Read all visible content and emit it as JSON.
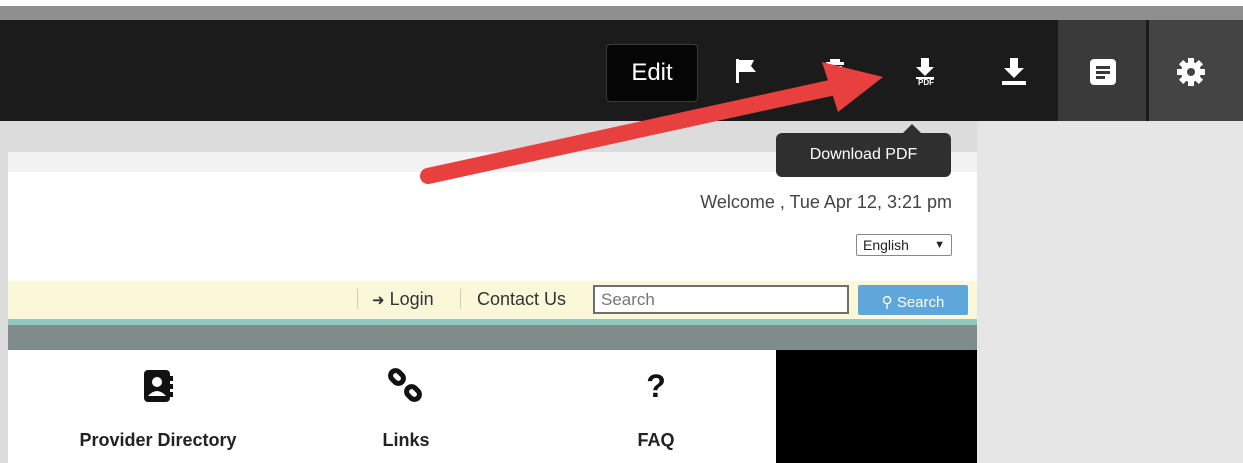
{
  "toolbar": {
    "edit_label": "Edit",
    "icons": [
      "flag-icon",
      "trash-icon",
      "download-pdf-icon",
      "download-icon",
      "document-icon",
      "gear-icon"
    ],
    "pdf_text": "PDF"
  },
  "tooltip": {
    "text": "Download PDF"
  },
  "header": {
    "welcome": "Welcome , Tue Apr 12, 3:21 pm",
    "language": "English"
  },
  "nav": {
    "login": "Login",
    "contact": "Contact Us",
    "search_placeholder": "Search",
    "search_button": "Search"
  },
  "tiles": [
    {
      "label": "Provider Directory",
      "icon": "address-book-icon"
    },
    {
      "label": "Links",
      "icon": "link-icon"
    },
    {
      "label": "FAQ",
      "icon": "question-icon"
    }
  ],
  "colors": {
    "toolbar_bg": "#1b1b1b",
    "annotation_arrow": "#e8403e",
    "nav_bg": "#fbf8da",
    "search_button": "#5fa7da"
  }
}
